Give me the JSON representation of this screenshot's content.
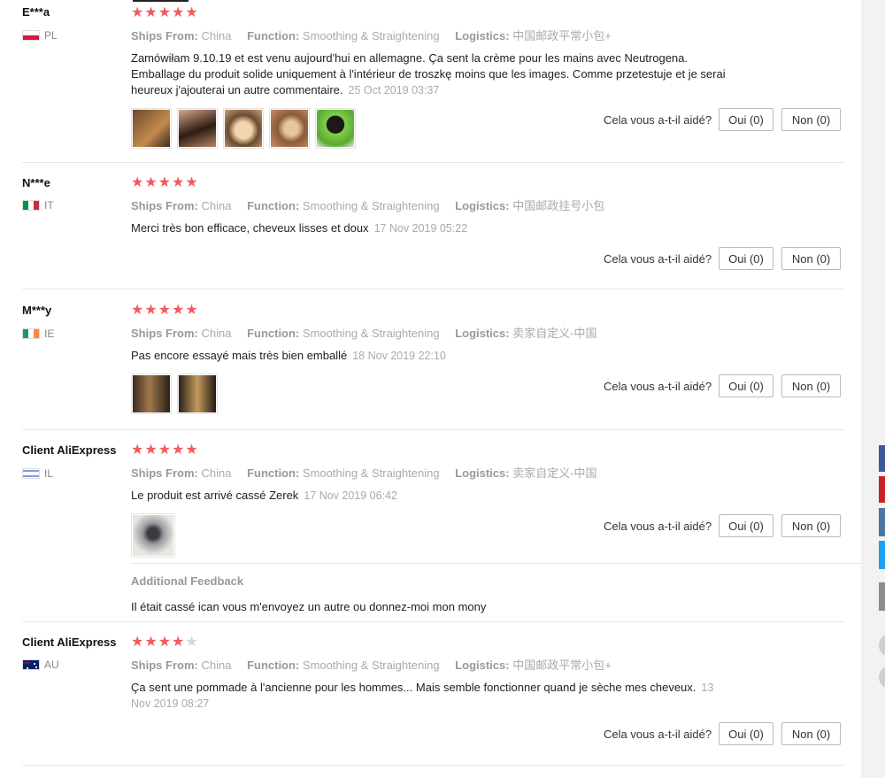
{
  "labels": {
    "ships_from": "Ships From:",
    "function": "Function:",
    "logistics": "Logistics:",
    "helpful_question": "Cela vous a-t-il aidé?",
    "additional_feedback": "Additional Feedback"
  },
  "colors": {
    "star_on": "#f25a5e",
    "star_off": "#d5d5d5",
    "share_facebook": "#3b5998",
    "share_pinterest": "#cb2027",
    "share_vk": "#4c75a3",
    "share_twitter": "#1da1f2",
    "share_more": "#8c8c8c"
  },
  "reviews": [
    {
      "user": "E***a",
      "country": "PL",
      "flag": "poland-flag-icon",
      "rating": 5,
      "ships_from": "China",
      "function": "Smoothing & Straightening",
      "logistics": "中国邮政平常小包+",
      "text": "Zamówiłam 9.10.19 et est venu aujourd'hui en allemagne. Ça sent la crème pour les mains avec Neutrogena. Emballage du produit solide uniquement à l'intérieur de troszkę moins que les images. Comme przetestuje et je serai heureux j'ajouterai un autre commentaire.",
      "date": "25 Oct 2019 03:37",
      "photos": 5,
      "yes": "Oui (0)",
      "no": "Non (0)"
    },
    {
      "user": "N***e",
      "country": "IT",
      "flag": "italy-flag-icon",
      "rating": 5,
      "ships_from": "China",
      "function": "Smoothing & Straightening",
      "logistics": "中国邮政挂号小包",
      "text": "Merci très bon efficace, cheveux lisses et doux",
      "date": "17 Nov 2019 05:22",
      "photos": 0,
      "yes": "Oui (0)",
      "no": "Non (0)"
    },
    {
      "user": "M***y",
      "country": "IE",
      "flag": "ireland-flag-icon",
      "rating": 5,
      "ships_from": "China",
      "function": "Smoothing & Straightening",
      "logistics": "卖家自定义-中国",
      "text": "Pas encore essayé mais très bien emballé",
      "date": "18 Nov 2019 22:10",
      "photos": 2,
      "yes": "Oui (0)",
      "no": "Non (0)"
    },
    {
      "user": "Client AliExpress",
      "country": "IL",
      "flag": "israel-flag-icon",
      "rating": 5,
      "ships_from": "China",
      "function": "Smoothing & Straightening",
      "logistics": "卖家自定义-中国",
      "text": "Le produit est arrivé cassé Zerek",
      "date": "17 Nov 2019 06:42",
      "photos": 1,
      "yes": "Oui (0)",
      "no": "Non (0)",
      "additional_feedback": "Il était cassé ican vous m'envoyez un autre ou donnez-moi mon mony"
    },
    {
      "user": "Client AliExpress",
      "country": "AU",
      "flag": "australia-flag-icon",
      "rating": 4,
      "ships_from": "China",
      "function": "Smoothing & Straightening",
      "logistics": "中国邮政平常小包+",
      "text": "Ça sent une pommade à l'ancienne pour les hommes... Mais semble fonctionner quand je sèche mes cheveux.",
      "date": "13 Nov 2019 08:27",
      "photos": 0,
      "yes": "Oui (0)",
      "no": "Non (0)"
    }
  ]
}
